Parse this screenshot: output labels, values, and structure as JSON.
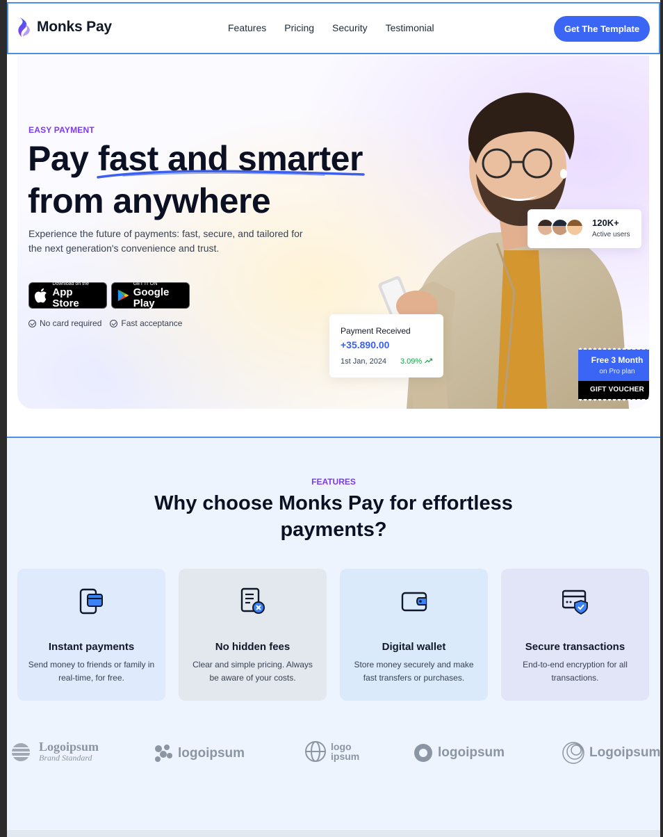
{
  "nav": {
    "brand": "Monks Pay",
    "links": [
      "Features",
      "Pricing",
      "Security",
      "Testimonial"
    ],
    "cta": "Get The Template"
  },
  "hero": {
    "eyebrow": "EASY PAYMENT",
    "title_pre": "Pay ",
    "title_highlight": "fast and smarter",
    "title_line2": "from anywhere",
    "description": "Experience the future of payments: fast, secure, and tailored for the next generation's convenience and trust.",
    "app_store": {
      "small": "Download on the",
      "big": "App Store"
    },
    "google_play": {
      "small": "GET IT ON",
      "big": "Google Play"
    },
    "checks": [
      "No card required",
      "Fast acceptance"
    ],
    "users": {
      "count": "120K+",
      "label": "Active users"
    },
    "payment": {
      "title": "Payment Received",
      "amount": "+35.890.00",
      "date": "1st Jan, 2024",
      "change": "3.09%"
    },
    "voucher": {
      "line1": "Free 3 Month",
      "line2": "on Pro plan",
      "line3": "GIFT VOUCHER"
    }
  },
  "features": {
    "eyebrow": "FEATURES",
    "title": "Why choose Monks Pay for effortless payments?",
    "cards": [
      {
        "icon": "card-payment-icon",
        "title": "Instant payments",
        "desc": "Send money to friends or family in real-time, for free."
      },
      {
        "icon": "invoice-cancel-icon",
        "title": "No hidden fees",
        "desc": "Clear and simple pricing. Always be aware of your costs."
      },
      {
        "icon": "wallet-icon",
        "title": "Digital wallet",
        "desc": "Store money securely and make fast transfers or purchases."
      },
      {
        "icon": "card-shield-icon",
        "title": "Secure transactions",
        "desc": "End-to-end encryption for all transactions."
      }
    ]
  },
  "logos": [
    {
      "name": "Logoipsum",
      "sub": "Brand Standard"
    },
    {
      "name": "logoipsum"
    },
    {
      "name": "logo",
      "sub": "ipsum"
    },
    {
      "name": "logoipsum"
    },
    {
      "name": "Logoipsum"
    }
  ],
  "colors": {
    "accent": "#3b66f5",
    "eyebrow": "#7c3aed",
    "positive": "#16a34a"
  }
}
